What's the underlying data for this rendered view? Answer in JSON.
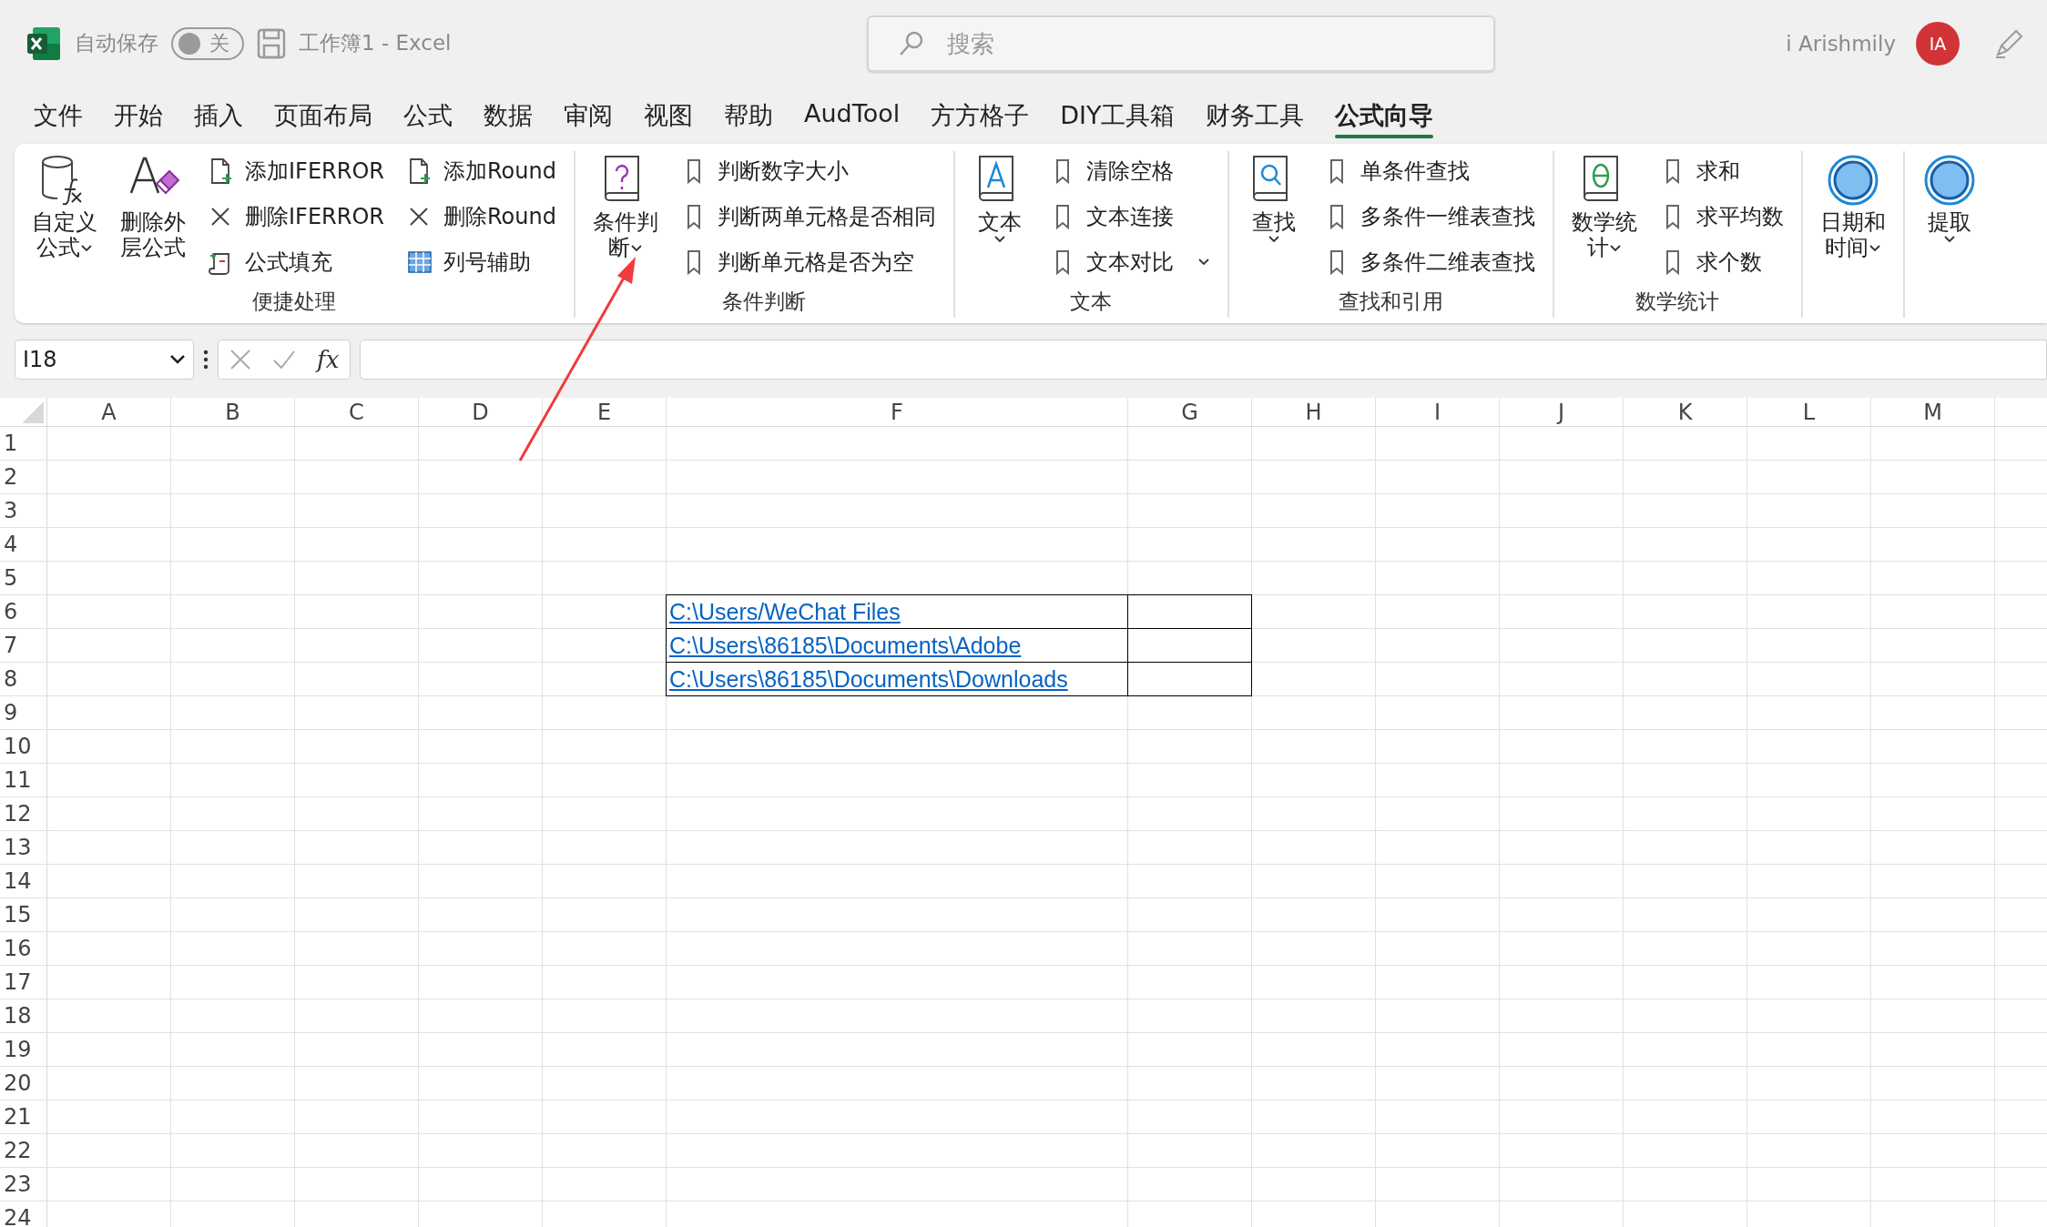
{
  "title_bar": {
    "autosave_label": "自动保存",
    "autosave_toggle": {
      "on": false,
      "label": "关"
    },
    "document": "工作簿1",
    "separator": "-",
    "app": "Excel",
    "search": {
      "placeholder": "搜索"
    },
    "user": "i Arishmily",
    "avatar": "IA"
  },
  "tabs": [
    {
      "label": "文件",
      "selected": false
    },
    {
      "label": "开始",
      "selected": false
    },
    {
      "label": "插入",
      "selected": false
    },
    {
      "label": "页面布局",
      "selected": false
    },
    {
      "label": "公式",
      "selected": false
    },
    {
      "label": "数据",
      "selected": false
    },
    {
      "label": "审阅",
      "selected": false
    },
    {
      "label": "视图",
      "selected": false
    },
    {
      "label": "帮助",
      "selected": false
    },
    {
      "label": "AudTool",
      "selected": false
    },
    {
      "label": "方方格子",
      "selected": false
    },
    {
      "label": "DIY工具箱",
      "selected": false
    },
    {
      "label": "财务工具",
      "selected": false
    },
    {
      "label": "公式向导",
      "selected": true
    }
  ],
  "ribbon": {
    "groups": [
      {
        "label": "便捷处理",
        "items": [
          {
            "kind": "large",
            "lines": [
              "自定义",
              "公式"
            ],
            "dropdown": true
          },
          {
            "kind": "large",
            "lines": [
              "删除外",
              "层公式"
            ],
            "dropdown": false
          },
          {
            "kind": "small",
            "label": "添加IFERROR",
            "dropdown": false
          },
          {
            "kind": "small",
            "label": "删除IFERROR",
            "dropdown": false
          },
          {
            "kind": "small",
            "label": "公式填充",
            "dropdown": false
          },
          {
            "kind": "small",
            "label": "添加Round",
            "dropdown": false
          },
          {
            "kind": "small",
            "label": "删除Round",
            "dropdown": false
          },
          {
            "kind": "small",
            "label": "列号辅助",
            "dropdown": false
          }
        ]
      },
      {
        "label": "条件判断",
        "items": [
          {
            "kind": "large",
            "lines": [
              "条件判",
              "断"
            ],
            "dropdown": true
          },
          {
            "kind": "small",
            "label": "判断数字大小",
            "dropdown": false
          },
          {
            "kind": "small",
            "label": "判断两单元格是否相同",
            "dropdown": false
          },
          {
            "kind": "small",
            "label": "判断单元格是否为空",
            "dropdown": false
          }
        ]
      },
      {
        "label": "文本",
        "items": [
          {
            "kind": "large",
            "lines": [
              "文本"
            ],
            "dropdown": true
          },
          {
            "kind": "small",
            "label": "清除空格",
            "dropdown": false
          },
          {
            "kind": "small",
            "label": "文本连接",
            "dropdown": false
          },
          {
            "kind": "small",
            "label": "文本对比",
            "dropdown": true
          }
        ]
      },
      {
        "label": "查找和引用",
        "items": [
          {
            "kind": "large",
            "lines": [
              "查找"
            ],
            "dropdown": true
          },
          {
            "kind": "small",
            "label": "单条件查找",
            "dropdown": false
          },
          {
            "kind": "small",
            "label": "多条件一维表查找",
            "dropdown": false
          },
          {
            "kind": "small",
            "label": "多条件二维表查找",
            "dropdown": false
          }
        ]
      },
      {
        "label": "数学统计",
        "items": [
          {
            "kind": "large",
            "lines": [
              "数学统",
              "计"
            ],
            "dropdown": true
          },
          {
            "kind": "small",
            "label": "求和",
            "dropdown": false
          },
          {
            "kind": "small",
            "label": "求平均数",
            "dropdown": false
          },
          {
            "kind": "small",
            "label": "求个数",
            "dropdown": false
          }
        ]
      },
      {
        "items": [
          {
            "kind": "large",
            "lines": [
              "日期和",
              "时间"
            ],
            "dropdown": true
          }
        ]
      },
      {
        "items": [
          {
            "kind": "large",
            "lines": [
              "提取"
            ],
            "dropdown": true
          }
        ]
      }
    ]
  },
  "formula_bar": {
    "name_box": "I18",
    "function_label": "fx"
  },
  "sheet": {
    "columns": [
      "A",
      "B",
      "C",
      "D",
      "E",
      "F",
      "G",
      "H",
      "I",
      "J",
      "K",
      "L",
      "M"
    ],
    "rows": [
      {
        "label": "1"
      },
      {
        "label": "2"
      },
      {
        "label": "3"
      },
      {
        "label": "4"
      },
      {
        "label": "5"
      },
      {
        "label": "6",
        "cells": [
          null,
          null,
          null,
          null,
          null,
          {
            "text": "C:\\Users/WeChat Files",
            "link": true,
            "bordered": true
          },
          {
            "bordered": true
          }
        ]
      },
      {
        "label": "7",
        "cells": [
          null,
          null,
          null,
          null,
          null,
          {
            "text": "C:\\Users\\86185\\Documents\\Adobe",
            "link": true,
            "bordered": true
          },
          {
            "bordered": true
          }
        ]
      },
      {
        "label": "8",
        "cells": [
          null,
          null,
          null,
          null,
          null,
          {
            "text": "C:\\Users\\86185\\Documents\\Downloads",
            "link": true,
            "bordered": true
          },
          {
            "bordered": true
          }
        ]
      },
      {
        "label": "9"
      },
      {
        "label": "10"
      },
      {
        "label": "11"
      },
      {
        "label": "12"
      },
      {
        "label": "13"
      },
      {
        "label": "14"
      },
      {
        "label": "15"
      },
      {
        "label": "16"
      },
      {
        "label": "17"
      },
      {
        "label": "18"
      },
      {
        "label": "19"
      },
      {
        "label": "20"
      },
      {
        "label": "21"
      },
      {
        "label": "22"
      },
      {
        "label": "23"
      },
      {
        "label": "24"
      }
    ]
  },
  "annotation": {
    "kind": "arrow"
  }
}
